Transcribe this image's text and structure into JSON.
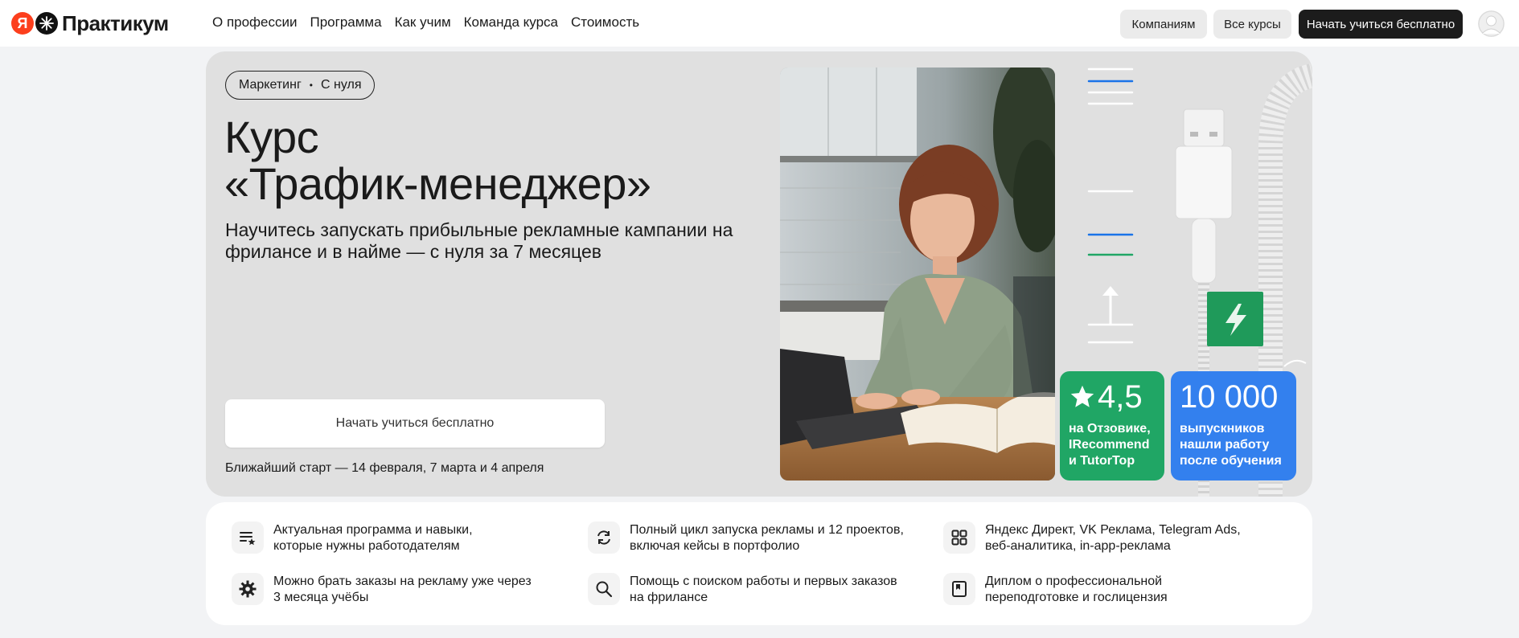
{
  "header": {
    "logo_badge": "Я",
    "logo_text": "Практикум",
    "nav": [
      "О профессии",
      "Программа",
      "Как учим",
      "Команда курса",
      "Стоимость"
    ],
    "companies_label": "Компаниям",
    "all_courses_label": "Все курсы",
    "start_free_label": "Начать учиться бесплатно"
  },
  "hero": {
    "tag_area": "Маркетинг",
    "tag_sep": "•",
    "tag_level": "С нуля",
    "title_line1": "Курс",
    "title_line2": "«Трафик-менеджер»",
    "subtitle": "Научитесь запускать прибыльные рекламные кампании на фрилансе и в найме — с нуля за 7 месяцев",
    "cta_label": "Начать учиться бесплатно",
    "next_start": "Ближайший старт — 14 февраля, 7 марта и 4 апреля"
  },
  "stats": [
    {
      "value": "4,5",
      "caption_lines": [
        "на Отзовике,",
        "IRecommend",
        "и TutorTop"
      ],
      "color": "#20a665"
    },
    {
      "value": "10 000",
      "caption_lines": [
        "выпускников",
        "нашли работу",
        "после обучения"
      ],
      "color": "#3380ee"
    }
  ],
  "features": [
    {
      "icon": "list-star-icon",
      "lines": [
        "Актуальная программа и навыки,",
        "которые нужны работодателям"
      ]
    },
    {
      "icon": "refresh-icon",
      "lines": [
        "Полный цикл запуска рекламы и 12 проектов,",
        "включая кейсы в портфолио"
      ]
    },
    {
      "icon": "grid-icon",
      "lines": [
        "Яндекс Директ, VK Реклама, Telegram Ads,",
        "веб-аналитика, in-app-реклама"
      ]
    },
    {
      "icon": "gear-icon",
      "lines": [
        "Можно брать заказы на рекламу уже через",
        "3 месяца учёбы"
      ]
    },
    {
      "icon": "search-icon",
      "lines": [
        "Помощь с поиском работы и первых заказов",
        "на фрилансе"
      ]
    },
    {
      "icon": "diploma-icon",
      "lines": [
        "Диплом о профессиональной",
        "переподготовке и гослицензия"
      ]
    }
  ],
  "colors": {
    "accent_green": "#20a665",
    "accent_blue": "#3380ee",
    "brand_red": "#fc3f1d"
  }
}
